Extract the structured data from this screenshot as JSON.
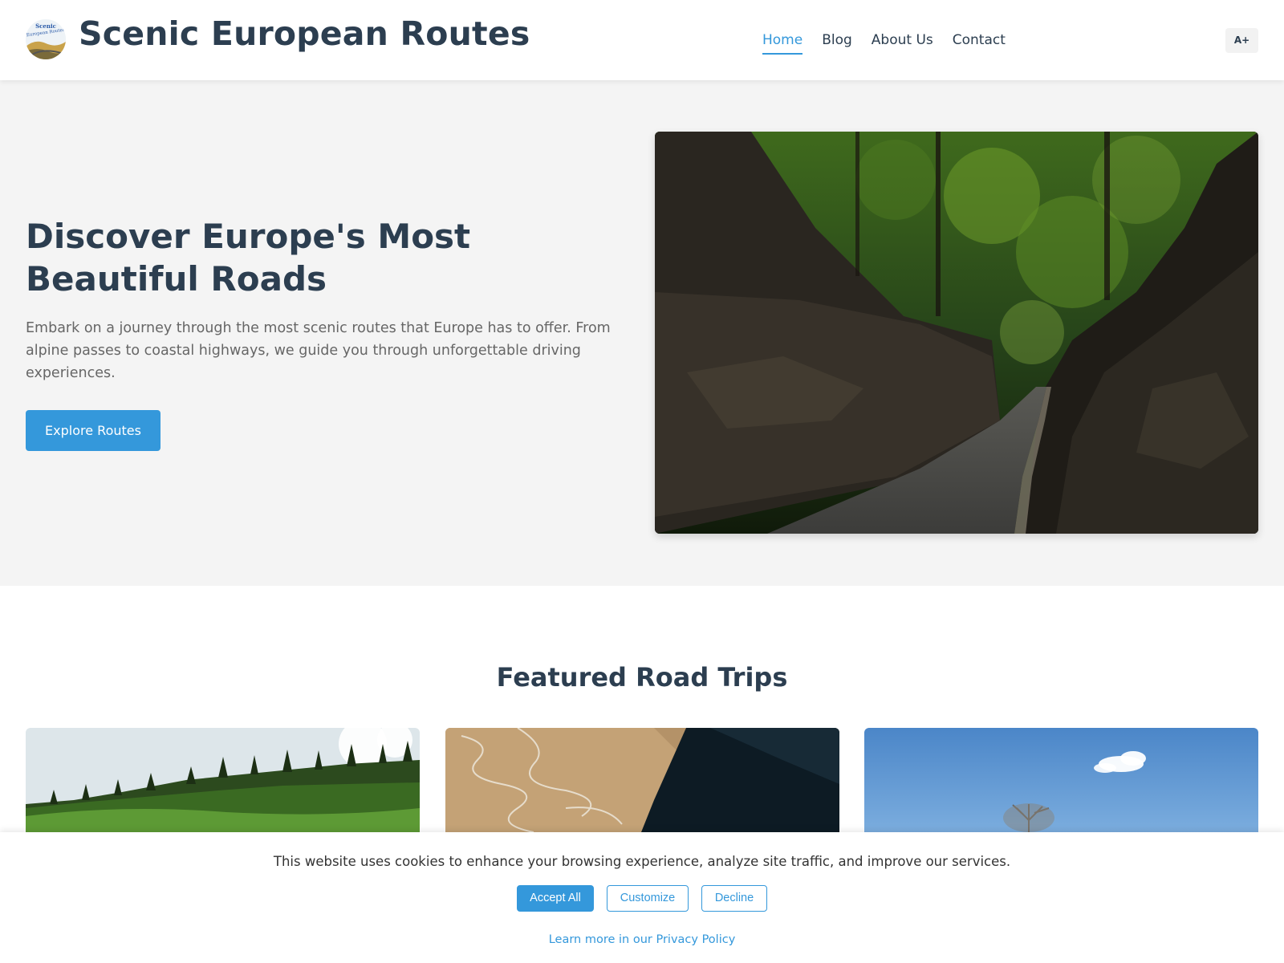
{
  "header": {
    "site_title": "Scenic European Routes",
    "logo_text": "Scenic European Routes",
    "nav": [
      {
        "label": "Home",
        "active": true
      },
      {
        "label": "Blog",
        "active": false
      },
      {
        "label": "About Us",
        "active": false
      },
      {
        "label": "Contact",
        "active": false
      }
    ],
    "font_size_button": "A+"
  },
  "hero": {
    "title": "Discover Europe's Most Beautiful Roads",
    "text": "Embark on a journey through the most scenic routes that Europe has to offer. From alpine passes to coastal highways, we guide you through unforgettable driving experiences.",
    "button": "Explore Routes",
    "image_icon": "forest-road-photo"
  },
  "featured": {
    "title": "Featured Road Trips",
    "cards": [
      {
        "image_icon": "alpine-meadow-photo"
      },
      {
        "image_icon": "mountain-pass-photo"
      },
      {
        "image_icon": "blue-sky-tree-photo"
      }
    ]
  },
  "cookie": {
    "text": "This website uses cookies to enhance your browsing experience, analyze site traffic, and improve our services.",
    "accept": "Accept All",
    "customize": "Customize",
    "decline": "Decline",
    "privacy_link": "Learn more in our Privacy Policy"
  },
  "colors": {
    "accent": "#3498db",
    "heading": "#2c3e50",
    "hero_bg": "#f4f4f4",
    "body_text": "#666666"
  }
}
